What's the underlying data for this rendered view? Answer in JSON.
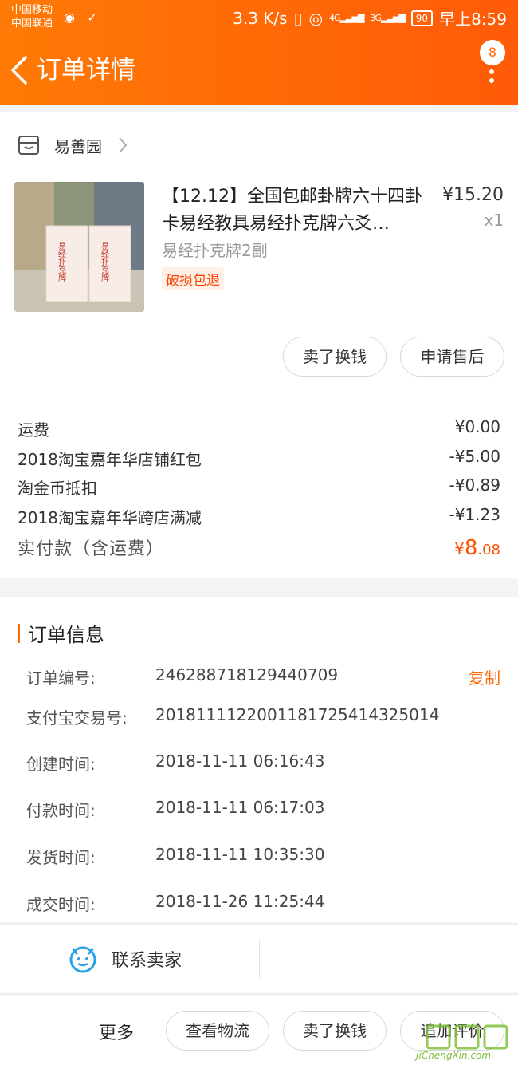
{
  "status_bar": {
    "carrier_1": "中国移动",
    "carrier_2": "中国联通",
    "speed": "3.3 K/s",
    "signal_1": "4G",
    "signal_2": "3G",
    "battery": "90",
    "time": "早上8:59"
  },
  "nav": {
    "title": "订单详情",
    "badge_count": "8"
  },
  "store": {
    "name": "易善园"
  },
  "product": {
    "title": "【12.12】全国包邮卦牌六十四卦卡易经教具易经扑克牌六爻…",
    "sku": "易经扑克牌2副",
    "tag": "破损包退",
    "price": "¥15.20",
    "qty": "x1",
    "image_text_1": "易经扑克牌",
    "image_text_2": "易经扑克牌"
  },
  "product_actions": {
    "sell": "卖了换钱",
    "after_sale": "申请售后"
  },
  "fees": [
    {
      "label": "运费",
      "value": "¥0.00"
    },
    {
      "label": "2018淘宝嘉年华店铺红包",
      "value": "-¥5.00"
    },
    {
      "label": "淘金币抵扣",
      "value": "-¥0.89"
    },
    {
      "label": "2018淘宝嘉年华跨店满减",
      "value": "-¥1.23"
    }
  ],
  "total": {
    "label": "实付款（含运费）",
    "currency": "¥",
    "integer": "8",
    "decimal": ".08"
  },
  "order_info": {
    "title": "订单信息",
    "rows": [
      {
        "label": "订单编号:",
        "value": "246288718129440709"
      },
      {
        "label": "支付宝交易号:",
        "value": "2018111122001181725414325014"
      },
      {
        "label": "创建时间:",
        "value": "2018-11-11 06:16:43"
      },
      {
        "label": "付款时间:",
        "value": "2018-11-11 06:17:03"
      },
      {
        "label": "发货时间:",
        "value": "2018-11-11 10:35:30"
      },
      {
        "label": "成交时间:",
        "value": "2018-11-26 11:25:44"
      }
    ],
    "copy_label": "复制"
  },
  "contact": {
    "label": "联系卖家"
  },
  "bottom": {
    "more": "更多",
    "logistics": "查看物流",
    "sell": "卖了换钱",
    "review": "追加评价"
  },
  "watermark": {
    "text": "JiChengXin.com"
  },
  "colors": {
    "accent": "#ff6a06",
    "price_red": "#ff5000",
    "tag_red": "#ff4400"
  }
}
